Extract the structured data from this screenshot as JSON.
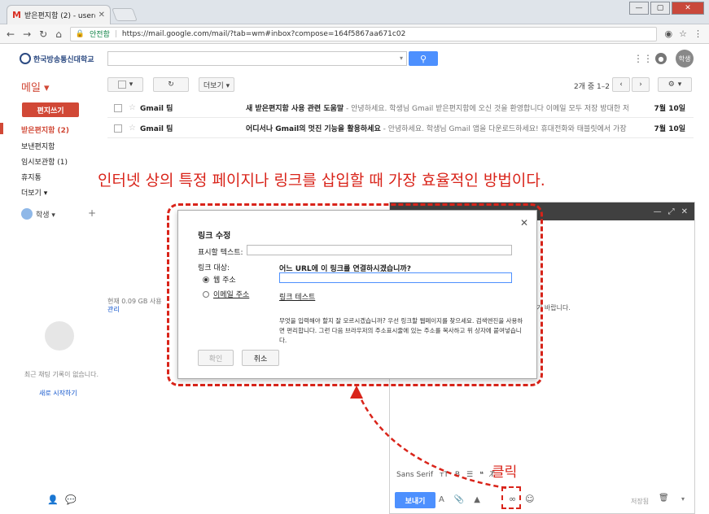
{
  "browser": {
    "tab_title": "받은편지함 (2) - user@",
    "tab_close": "✕",
    "secure_label": "안전함",
    "url": "https://mail.google.com/mail/?tab=wm#inbox?compose=164f5867aa671c02",
    "window_controls": [
      "—",
      "▢",
      "✕"
    ]
  },
  "gmail": {
    "logo_text": "한국방송통신대학교",
    "avatar_label": "학생",
    "mail_label": "메일 ▾",
    "more_label": "더보기 ▾",
    "page_count": "2개 중 1–2",
    "compose_label": "편지쓰기",
    "sidebar": [
      {
        "label": "받은편지함 (2)",
        "active": true
      },
      {
        "label": "보낸편지함",
        "active": false
      },
      {
        "label": "임시보관함 (1)",
        "active": false
      },
      {
        "label": "휴지통",
        "active": false
      },
      {
        "label": "더보기 ▾",
        "active": false
      }
    ],
    "user_name": "학생 ▾",
    "storage_text": "현재 0.09 GB 사용",
    "storage_link": "관리",
    "chat_empty": "최근 채팅 기록이 없습니다.",
    "chat_start": "새로 시작하기",
    "mails": [
      {
        "sender": "Gmail 팀",
        "subject": "새 받은편지함 사용 관련 도움말",
        "snippet": " - 안녕하세요. 학생님 Gmail 받은편지함에 오신 것을 환영합니다 이메일 모두 저장 방대한 저",
        "date": "7월 10일"
      },
      {
        "sender": "Gmail 팀",
        "subject": "어디서나 Gmail의 멋진 기능을 활용하세요",
        "snippet": " - 안녕하세요. 학생님 Gmail 앱을 다운로드하세요! 휴대전화와 태블릿에서 가장 완",
        "date": "7월 10일"
      }
    ]
  },
  "annotation": {
    "headline": "인터넷 상의 특정 페이지나 링크를 삽입할 때 가장 효율적인 방법이다.",
    "click": "클릭"
  },
  "compose": {
    "bg_text": "기 바랍니다.",
    "font_name": "Sans Serif",
    "send_label": "보내기",
    "saved_label": "저장됨"
  },
  "dialog": {
    "close": "✕",
    "title": "링크 수정",
    "display_text_label": "표시할 텍스트:",
    "link_target_label": "링크 대상:",
    "option_web": "웹 주소",
    "option_email": "이메일 주소",
    "question": "어느 URL에 이 링크를 연결하시겠습니까?",
    "test_link": "링크 테스트",
    "help_text": "무엇을 입력해야 할지 잘 모르시겠습니까? 우선 링크할 웹페이지를 찾으세요. 검색엔진을 사용하면 편리합니다. 그런 다음 브라우저의 주소표시줄에 있는 주소를 복사하고 위 상자에 붙여넣습니다.",
    "ok_label": "확인",
    "cancel_label": "취소"
  },
  "colors": {
    "gmail_red": "#d14836",
    "accent_blue": "#4d90fe",
    "annotation_red": "#d9241a"
  }
}
